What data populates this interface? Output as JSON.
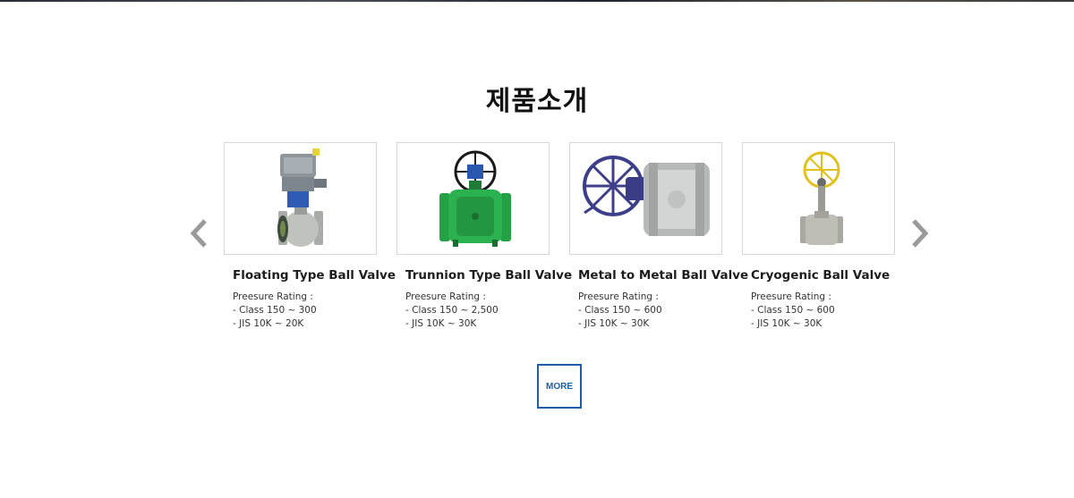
{
  "section": {
    "title": "제품소개"
  },
  "carousel": {
    "prev_icon": "chevron-left-icon",
    "next_icon": "chevron-right-icon",
    "arrow_color": "#9a9a9a"
  },
  "products": [
    {
      "name": "Floating Type Ball Valve",
      "spec_heading": "Preesure Rating :",
      "spec_lines": [
        "- Class 150 ~ 300",
        "- JIS 10K ~ 20K"
      ],
      "image": "electric-actuated-ball-valve"
    },
    {
      "name": "Trunnion Type Ball Valve",
      "spec_heading": "Preesure Rating :",
      "spec_lines": [
        "- Class 150 ~ 2,500",
        "- JIS 10K ~ 30K"
      ],
      "image": "green-trunnion-ball-valve"
    },
    {
      "name": "Metal to Metal Ball Valve",
      "spec_heading": "Preesure Rating :",
      "spec_lines": [
        "- Class 150 ~ 600",
        "- JIS 10K ~ 30K"
      ],
      "image": "metal-seated-ball-valve"
    },
    {
      "name": "Cryogenic Ball Valve",
      "spec_heading": "Preesure Rating :",
      "spec_lines": [
        "- Class 150 ~ 600",
        "- JIS 10K ~ 30K"
      ],
      "image": "cryogenic-ball-valve"
    }
  ],
  "more_button": {
    "label": "MORE",
    "color": "#1d5ea8"
  }
}
